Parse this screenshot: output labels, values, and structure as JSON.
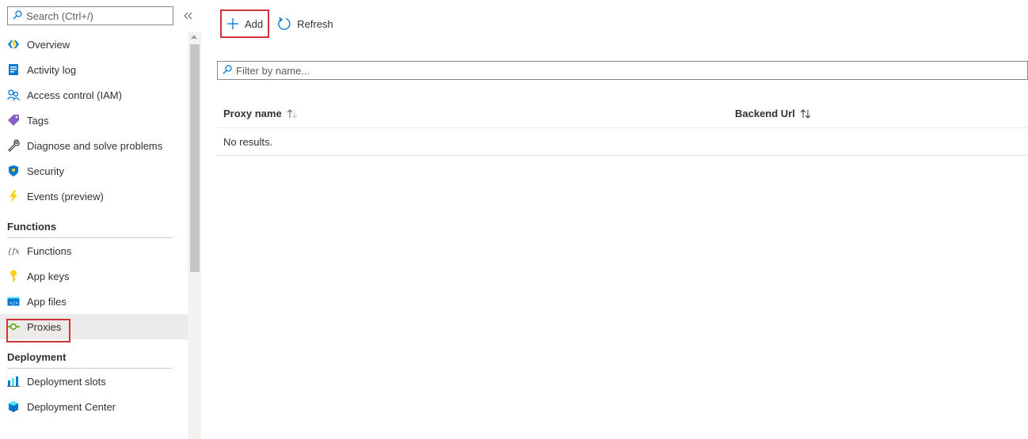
{
  "sidebar": {
    "search_placeholder": "Search (Ctrl+/)",
    "items": [
      {
        "label": "Overview",
        "icon": "lightning-bolt-icon"
      },
      {
        "label": "Activity log",
        "icon": "document-log-icon"
      },
      {
        "label": "Access control (IAM)",
        "icon": "people-icon"
      },
      {
        "label": "Tags",
        "icon": "tag-icon"
      },
      {
        "label": "Diagnose and solve problems",
        "icon": "wrench-icon"
      },
      {
        "label": "Security",
        "icon": "shield-icon"
      },
      {
        "label": "Events (preview)",
        "icon": "bolt-icon"
      }
    ],
    "sections": [
      {
        "title": "Functions",
        "items": [
          {
            "label": "Functions",
            "icon": "function-icon"
          },
          {
            "label": "App keys",
            "icon": "key-icon"
          },
          {
            "label": "App files",
            "icon": "code-file-icon"
          },
          {
            "label": "Proxies",
            "icon": "proxy-icon",
            "active": true
          }
        ]
      },
      {
        "title": "Deployment",
        "items": [
          {
            "label": "Deployment slots",
            "icon": "slots-icon"
          },
          {
            "label": "Deployment Center",
            "icon": "cube-icon"
          }
        ]
      }
    ]
  },
  "toolbar": {
    "add_label": "Add",
    "refresh_label": "Refresh"
  },
  "filter": {
    "placeholder": "Filter by name..."
  },
  "grid": {
    "columns": [
      "Proxy name",
      "Backend Url"
    ],
    "empty_text": "No results."
  },
  "colors": {
    "highlight": "#d13438",
    "accent": "#0078d4",
    "active_bg": "#edebe9"
  }
}
